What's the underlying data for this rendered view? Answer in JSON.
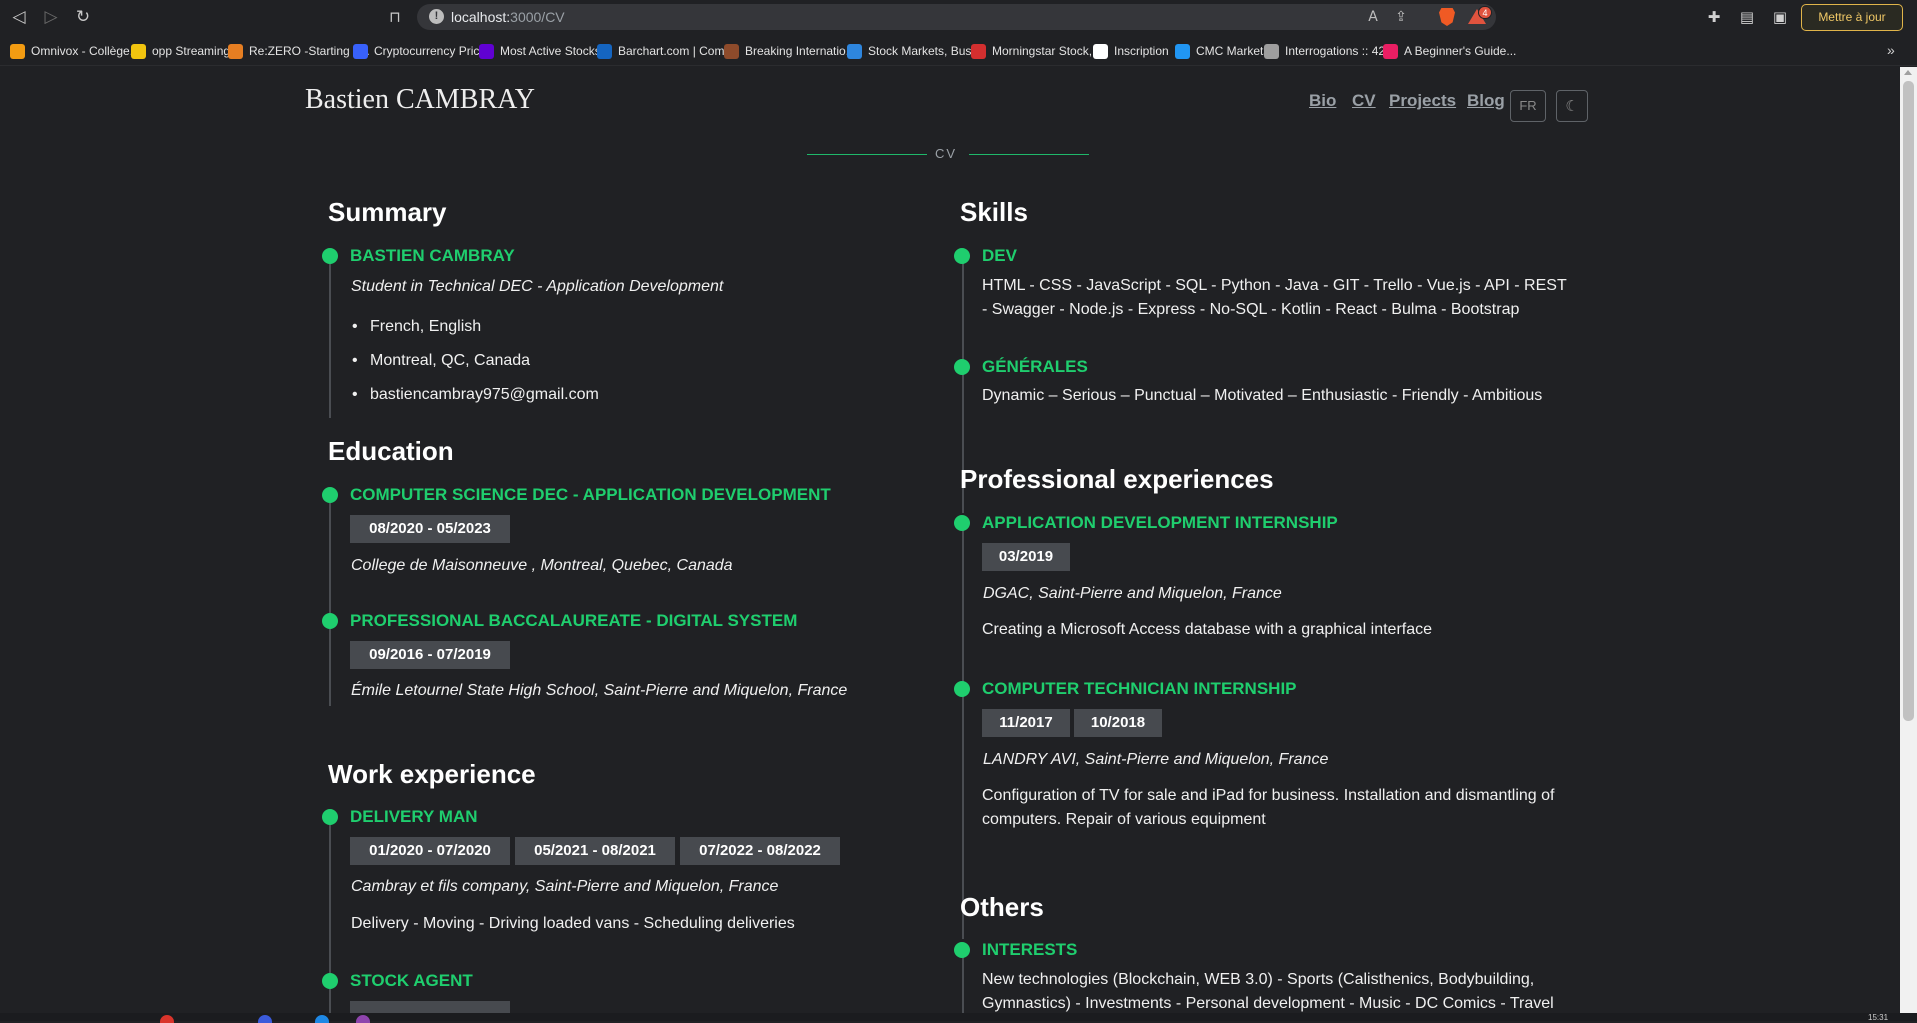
{
  "browser": {
    "url_host": "localhost:",
    "url_path": "3000/CV",
    "update_label": "Mettre à jour",
    "more": "»",
    "brave_count": "4",
    "bookmarks": [
      {
        "label": "Omnivox - Collège...",
        "color": "#f39c12"
      },
      {
        "label": "opp Streaming",
        "color": "#f1c40f"
      },
      {
        "label": "Re:ZERO -Starting L...",
        "color": "#e67e22"
      },
      {
        "label": "Cryptocurrency Pric...",
        "color": "#3861fb"
      },
      {
        "label": "Most Active Stocks...",
        "color": "#6001d2"
      },
      {
        "label": "Barchart.com | Com...",
        "color": "#1565c0"
      },
      {
        "label": "Breaking Internatio...",
        "color": "#8e4b2b"
      },
      {
        "label": "Stock Markets, Busi...",
        "color": "#2e86de"
      },
      {
        "label": "Morningstar Stock,...",
        "color": "#d32f2f"
      },
      {
        "label": "Inscription",
        "color": "#ffffff"
      },
      {
        "label": "CMC Markets",
        "color": "#2196f3"
      },
      {
        "label": "Interrogations :: 42...",
        "color": "#9e9e9e"
      },
      {
        "label": "A Beginner's Guide...",
        "color": "#e91e63"
      }
    ]
  },
  "site": {
    "title": "Bastien CAMBRAY",
    "nav": [
      "Bio",
      "CV",
      "Projects",
      "Blog"
    ],
    "lang": "FR",
    "divider": "CV"
  },
  "summary": {
    "title": "Summary",
    "name": "BASTIEN CAMBRAY",
    "subtitle": "Student in Technical DEC - Application Development",
    "bullets": [
      "French, English",
      "Montreal, QC, Canada",
      "bastiencambray975@gmail.com"
    ]
  },
  "education": {
    "title": "Education",
    "items": [
      {
        "title": "COMPUTER SCIENCE DEC - APPLICATION DEVELOPMENT",
        "dates": [
          "08/2020 - 05/2023"
        ],
        "place": "College de Maisonneuve , Montreal, Quebec, Canada"
      },
      {
        "title": "PROFESSIONAL BACCALAUREATE - DIGITAL SYSTEM",
        "dates": [
          "09/2016 - 07/2019"
        ],
        "place": "Émile Letournel State High School, Saint-Pierre and Miquelon, France"
      }
    ]
  },
  "work": {
    "title": "Work experience",
    "items": [
      {
        "title": "DELIVERY MAN",
        "dates": [
          "01/2020 - 07/2020",
          "05/2021 - 08/2021",
          "07/2022 - 08/2022"
        ],
        "place": "Cambray et fils company, Saint-Pierre and Miquelon, France",
        "desc": "Delivery - Moving - Driving loaded vans - Scheduling deliveries"
      },
      {
        "title": "STOCK AGENT"
      }
    ]
  },
  "skills": {
    "title": "Skills",
    "items": [
      {
        "title": "DEV",
        "line1": "HTML - CSS - JavaScript - SQL - Python - Java - GIT - Trello - Vue.js - API - REST",
        "line2": "- Swagger - Node.js - Express - No-SQL - Kotlin - React - Bulma - Bootstrap"
      },
      {
        "title": "GÉNÉRALES",
        "line1": "Dynamic – Serious – Punctual – Motivated – Enthusiastic - Friendly - Ambitious"
      }
    ]
  },
  "pro": {
    "title": "Professional experiences",
    "items": [
      {
        "title": "APPLICATION DEVELOPMENT INTERNSHIP",
        "dates": [
          "03/2019"
        ],
        "place": "DGAC, Saint-Pierre and Miquelon, France",
        "desc1": "Creating a Microsoft Access database with a graphical interface"
      },
      {
        "title": "COMPUTER TECHNICIAN INTERNSHIP",
        "dates": [
          "11/2017",
          "10/2018"
        ],
        "place": "LANDRY AVI, Saint-Pierre and Miquelon, France",
        "desc1": "Configuration of TV for sale and iPad for business. Installation and dismantling of",
        "desc2": "computers. Repair of various equipment"
      }
    ]
  },
  "others": {
    "title": "Others",
    "items": [
      {
        "title": "INTERESTS",
        "line1": "New technologies (Blockchain, WEB 3.0) - Sports (Calisthenics, Bodybuilding,",
        "line2": "Gymnastics) - Investments - Personal development - Music - DC Comics - Travel"
      }
    ]
  },
  "taskbar": {
    "clock": "15:31"
  }
}
